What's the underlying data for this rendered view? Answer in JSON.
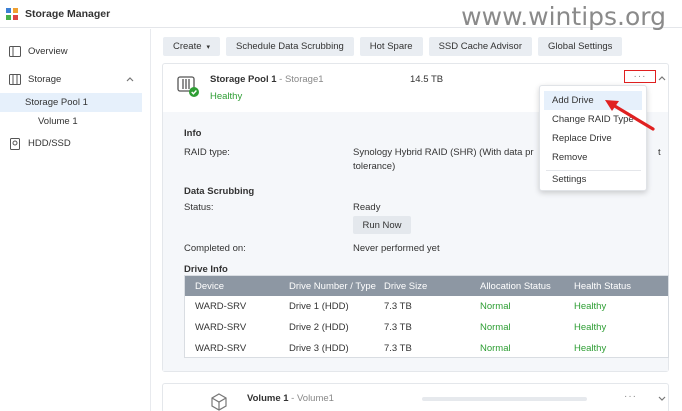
{
  "window": {
    "title": "Storage Manager"
  },
  "watermark": "www.wintips.org",
  "sidebar": {
    "items": [
      {
        "label": "Overview",
        "icon": "overview-icon"
      },
      {
        "label": "Storage",
        "icon": "storage-icon"
      },
      {
        "label": "Storage Pool 1"
      },
      {
        "label": "Volume 1"
      },
      {
        "label": "HDD/SSD",
        "icon": "hdd-icon"
      }
    ]
  },
  "toolbar": {
    "buttons": [
      "Create",
      "Schedule Data Scrubbing",
      "Hot Spare",
      "SSD Cache Advisor",
      "Global Settings"
    ]
  },
  "pool": {
    "name": "Storage Pool 1",
    "sub": " - Storage1",
    "size": "14.5 TB",
    "status": "Healthy",
    "info_title": "Info",
    "raid_label": "RAID type:",
    "raid_value_line1": "Synology Hybrid RAID (SHR) (With data pr",
    "raid_value_line1_tail": "t",
    "raid_value_line2": "tolerance)",
    "scrub_title": "Data Scrubbing",
    "status_label": "Status:",
    "status_value": "Ready",
    "run_now": "Run Now",
    "completed_label": "Completed on:",
    "completed_value": "Never performed yet",
    "drive_info_title": "Drive Info"
  },
  "drive_table": {
    "columns": [
      "Device",
      "Drive Number / Type",
      "Drive Size",
      "Allocation Status",
      "Health Status"
    ],
    "rows": [
      [
        "WARD-SRV",
        "Drive 1 (HDD)",
        "7.3 TB",
        "Normal",
        "Healthy"
      ],
      [
        "WARD-SRV",
        "Drive 2 (HDD)",
        "7.3 TB",
        "Normal",
        "Healthy"
      ],
      [
        "WARD-SRV",
        "Drive 3 (HDD)",
        "7.3 TB",
        "Normal",
        "Healthy"
      ]
    ]
  },
  "volume": {
    "name": "Volume 1",
    "sub": " - Volume1"
  },
  "menu": {
    "items": [
      "Add Drive",
      "Change RAID Type",
      "Replace Drive",
      "Remove",
      "Settings"
    ]
  },
  "colors": {
    "healthy": "#2e9e34",
    "highlight": "#e02020",
    "accent": "#1a73c8"
  }
}
